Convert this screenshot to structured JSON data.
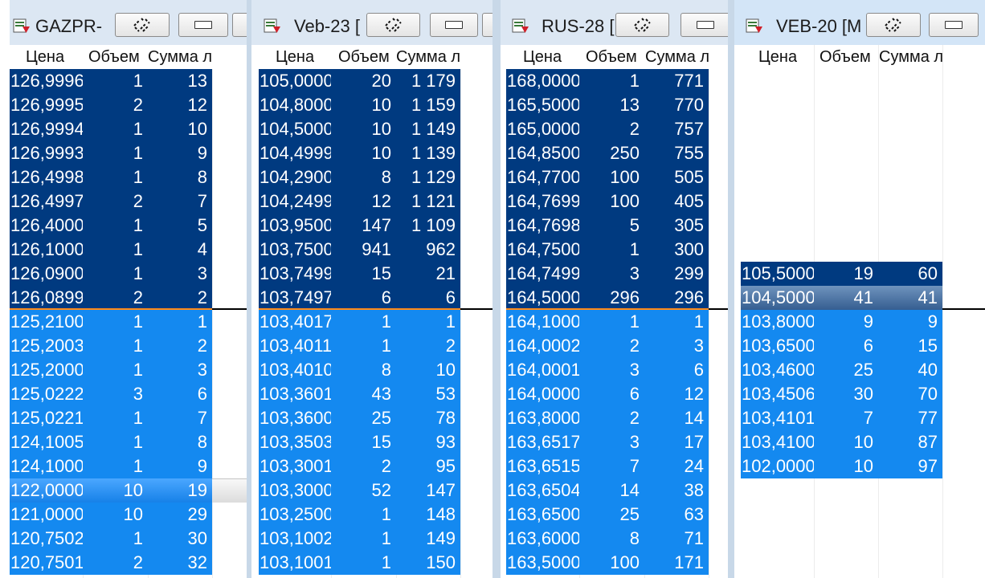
{
  "columns": {
    "price": "Цена",
    "volume": "Объем",
    "sum": "Сумма л"
  },
  "panels": [
    {
      "title": "GAZPR-",
      "sell": [
        [
          "126,9996",
          "1",
          "13"
        ],
        [
          "126,9995",
          "2",
          "12"
        ],
        [
          "126,9994",
          "1",
          "10"
        ],
        [
          "126,9993",
          "1",
          "9"
        ],
        [
          "126,4998",
          "1",
          "8"
        ],
        [
          "126,4997",
          "2",
          "7"
        ],
        [
          "126,4000",
          "1",
          "5"
        ],
        [
          "126,1000",
          "1",
          "4"
        ],
        [
          "126,0900",
          "1",
          "3"
        ],
        [
          "126,0899",
          "2",
          "2"
        ]
      ],
      "buy": [
        [
          "125,2100",
          "1",
          "1"
        ],
        [
          "125,2003",
          "1",
          "2"
        ],
        [
          "125,2000",
          "1",
          "3"
        ],
        [
          "125,0222",
          "3",
          "6"
        ],
        [
          "125,0221",
          "1",
          "7"
        ],
        [
          "124,1005",
          "1",
          "8"
        ],
        [
          "124,1000",
          "1",
          "9"
        ],
        [
          "122,0000",
          "10",
          "19"
        ],
        [
          "121,0000",
          "10",
          "29"
        ],
        [
          "120,7502",
          "1",
          "30"
        ],
        [
          "120,7501",
          "2",
          "32"
        ]
      ]
    },
    {
      "title": "Veb-23 [",
      "sell": [
        [
          "105,0000",
          "20",
          "1 179"
        ],
        [
          "104,8000",
          "10",
          "1 159"
        ],
        [
          "104,5000",
          "10",
          "1 149"
        ],
        [
          "104,4999",
          "10",
          "1 139"
        ],
        [
          "104,2900",
          "8",
          "1 129"
        ],
        [
          "104,2499",
          "12",
          "1 121"
        ],
        [
          "103,9500",
          "147",
          "1 109"
        ],
        [
          "103,7500",
          "941",
          "962"
        ],
        [
          "103,7499",
          "15",
          "21"
        ],
        [
          "103,7497",
          "6",
          "6"
        ]
      ],
      "buy": [
        [
          "103,4017",
          "1",
          "1"
        ],
        [
          "103,4011",
          "1",
          "2"
        ],
        [
          "103,4010",
          "8",
          "10"
        ],
        [
          "103,3601",
          "43",
          "53"
        ],
        [
          "103,3600",
          "25",
          "78"
        ],
        [
          "103,3503",
          "15",
          "93"
        ],
        [
          "103,3001",
          "2",
          "95"
        ],
        [
          "103,3000",
          "52",
          "147"
        ],
        [
          "103,2500",
          "1",
          "148"
        ],
        [
          "103,1002",
          "1",
          "149"
        ],
        [
          "103,1001",
          "1",
          "150"
        ]
      ]
    },
    {
      "title": "RUS-28 [",
      "sell": [
        [
          "168,0000",
          "1",
          "771"
        ],
        [
          "165,5000",
          "13",
          "770"
        ],
        [
          "165,0000",
          "2",
          "757"
        ],
        [
          "164,8500",
          "250",
          "755"
        ],
        [
          "164,7700",
          "100",
          "505"
        ],
        [
          "164,7699",
          "100",
          "405"
        ],
        [
          "164,7698",
          "5",
          "305"
        ],
        [
          "164,7500",
          "1",
          "300"
        ],
        [
          "164,7499",
          "3",
          "299"
        ],
        [
          "164,5000",
          "296",
          "296"
        ]
      ],
      "buy": [
        [
          "164,1000",
          "1",
          "1"
        ],
        [
          "164,0002",
          "2",
          "3"
        ],
        [
          "164,0001",
          "3",
          "6"
        ],
        [
          "164,0000",
          "6",
          "12"
        ],
        [
          "163,8000",
          "2",
          "14"
        ],
        [
          "163,6517",
          "3",
          "17"
        ],
        [
          "163,6515",
          "7",
          "24"
        ],
        [
          "163,6504",
          "14",
          "38"
        ],
        [
          "163,6500",
          "25",
          "63"
        ],
        [
          "163,6000",
          "8",
          "71"
        ],
        [
          "163,5000",
          "100",
          "171"
        ]
      ]
    },
    {
      "title": "VEB-20 [M",
      "sell": [
        [
          "105,5000",
          "19",
          "60"
        ],
        [
          "104,5000",
          "41",
          "41"
        ]
      ],
      "buy": [
        [
          "103,8000",
          "9",
          "9"
        ],
        [
          "103,6500",
          "6",
          "15"
        ],
        [
          "103,4600",
          "25",
          "40"
        ],
        [
          "103,4506",
          "30",
          "70"
        ],
        [
          "103,4101",
          "7",
          "77"
        ],
        [
          "103,4100",
          "10",
          "87"
        ],
        [
          "102,0000",
          "10",
          "97"
        ]
      ]
    }
  ]
}
